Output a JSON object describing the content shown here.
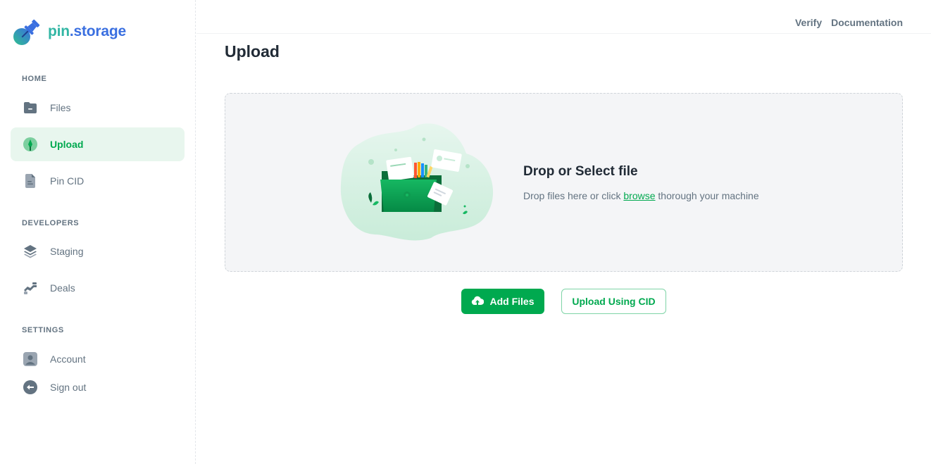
{
  "brand": {
    "name_part1": "pin",
    "name_part2": ".storage",
    "icon": "pushpin-logo-icon"
  },
  "header": {
    "links": [
      {
        "label": "Verify"
      },
      {
        "label": "Documentation"
      }
    ]
  },
  "sidebar": {
    "sections": [
      {
        "label": "HOME",
        "items": [
          {
            "label": "Files",
            "icon": "folder-icon",
            "active": false
          },
          {
            "label": "Upload",
            "icon": "upload-icon",
            "active": true
          },
          {
            "label": "Pin CID",
            "icon": "document-icon",
            "active": false
          }
        ]
      },
      {
        "label": "DEVELOPERS",
        "items": [
          {
            "label": "Staging",
            "icon": "layers-icon",
            "active": false
          },
          {
            "label": "Deals",
            "icon": "handshake-icon",
            "active": false
          }
        ]
      },
      {
        "label": "SETTINGS",
        "items": [
          {
            "label": "Account",
            "icon": "user-icon",
            "active": false
          },
          {
            "label": "Sign out",
            "icon": "sign-out-icon",
            "active": false
          }
        ]
      }
    ]
  },
  "main": {
    "title": "Upload",
    "dropzone": {
      "title": "Drop or Select file",
      "subtitle_before": "Drop files here or click ",
      "subtitle_link": "browse",
      "subtitle_after": " thorough your machine",
      "illustration": "folder-with-files-illustration"
    },
    "buttons": {
      "add_files": "Add Files",
      "upload_cid": "Upload Using CID"
    }
  },
  "colors": {
    "accent": "#00a94f",
    "active_bg": "#e8f6ee",
    "muted_text": "#637381",
    "dropzone_bg": "#f4f5f7"
  }
}
